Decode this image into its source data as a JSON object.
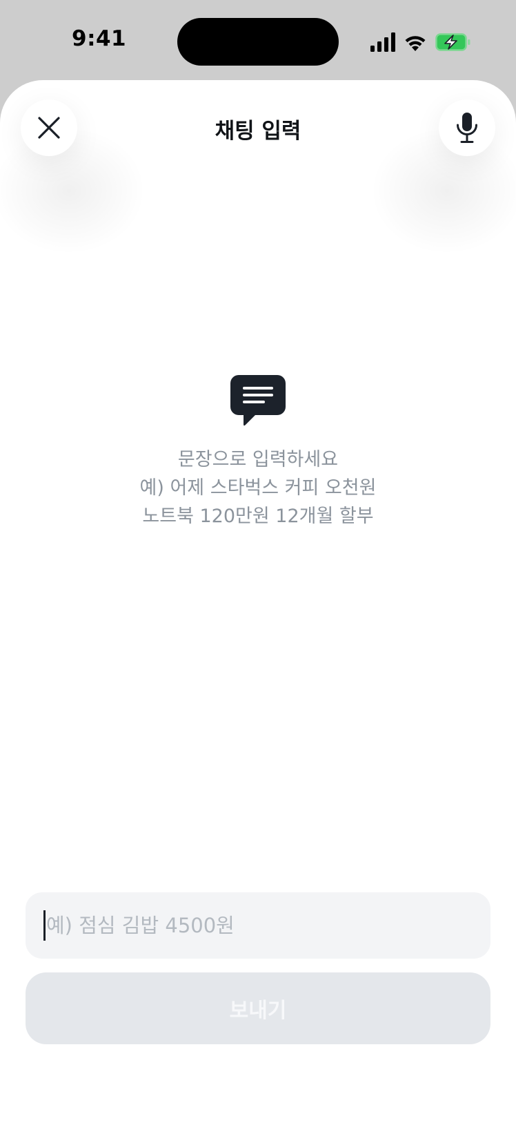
{
  "status_bar": {
    "time": "9:41"
  },
  "header": {
    "title": "채팅 입력",
    "close_icon": "close-icon",
    "mic_icon": "microphone-icon"
  },
  "empty_state": {
    "icon": "chat-bubble-icon",
    "lines": [
      "문장으로 입력하세요",
      "예) 어제 스타벅스 커피 오천원",
      "노트북 120만원 12개월 할부"
    ]
  },
  "input": {
    "value": "",
    "placeholder": "예) 점심 김밥 4500원"
  },
  "send_button": {
    "label": "보내기",
    "state": "disabled"
  },
  "colors": {
    "sheet_background": "#ffffff",
    "backdrop": "#cdcdcd",
    "hint_text": "#8b939c",
    "input_background": "#f3f4f6",
    "button_disabled_background": "#e4e7eb",
    "battery_charging": "#34c759",
    "icon_dark": "#1a1f27"
  }
}
